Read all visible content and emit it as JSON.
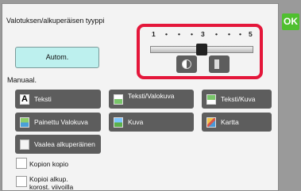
{
  "title": "Valotuksen/alkuperäisen tyyppi",
  "ok_label": "OK",
  "auto_label": "Autom.",
  "manual_label": "Manuaal.",
  "scale": {
    "labels": [
      "1",
      "•",
      "•",
      "•",
      "3",
      "•",
      "•",
      "•",
      "5"
    ],
    "value": 3
  },
  "buttons": {
    "teksti": "Teksti",
    "teksti_valokuva": "Teksti/Valokuva",
    "teksti_kuva": "Teksti/Kuva",
    "painettu_valokuva": "Painettu Valokuva",
    "kuva": "Kuva",
    "kartta": "Kartta",
    "vaalea": "Vaalea alkuperäinen"
  },
  "checks": {
    "kopion_kopio": "Kopion kopio",
    "kopioi_line1": "Kopioi alkup.",
    "kopioi_line2": "korost. viivoilla"
  },
  "icons": {
    "teksti": "text-icon",
    "teksti_valokuva": "text-photo-icon",
    "teksti_kuva": "text-image-icon",
    "painettu_valokuva": "printed-photo-icon",
    "kuva": "photo-icon",
    "kartta": "map-icon",
    "vaalea": "light-original-icon",
    "lighter": "lighter-icon",
    "darker": "darker-icon"
  },
  "colors": {
    "ok": "#4fbf2f",
    "highlight": "#e4163a",
    "auto_bg": "#bdf0ee",
    "button_bg": "#5d5d5d"
  }
}
